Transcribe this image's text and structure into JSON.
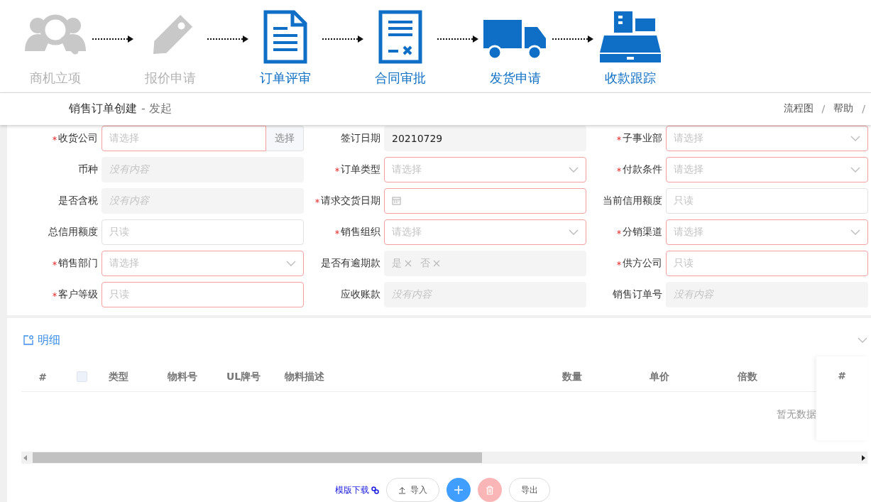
{
  "steps": [
    {
      "label": "商机立项",
      "active": false
    },
    {
      "label": "报价申请",
      "active": false
    },
    {
      "label": "订单评审",
      "active": true
    },
    {
      "label": "合同审批",
      "active": true
    },
    {
      "label": "发货申请",
      "active": true
    },
    {
      "label": "收款跟踪",
      "active": true
    }
  ],
  "title_bar": {
    "title": "销售订单创建",
    "subtitle": "- 发起",
    "links": [
      "流程图",
      "帮助"
    ],
    "separator": "/"
  },
  "fields": [
    {
      "label": "收货公司",
      "kind": "picker",
      "required": true,
      "invalid": true,
      "disabled": false,
      "placeholder": "请选择",
      "button": "选择"
    },
    {
      "label": "签订日期",
      "kind": "input",
      "required": false,
      "invalid": false,
      "disabled": true,
      "value": "20210729"
    },
    {
      "label": "子事业部",
      "kind": "select",
      "required": true,
      "invalid": true,
      "disabled": false,
      "placeholder": "请选择"
    },
    {
      "label": "币种",
      "kind": "input",
      "required": false,
      "invalid": false,
      "disabled": true,
      "placeholder": "没有内容"
    },
    {
      "label": "订单类型",
      "kind": "select",
      "required": true,
      "invalid": true,
      "disabled": false,
      "placeholder": "请选择"
    },
    {
      "label": "付款条件",
      "kind": "select",
      "required": true,
      "invalid": true,
      "disabled": false,
      "placeholder": "请选择"
    },
    {
      "label": "是否含税",
      "kind": "input",
      "required": false,
      "invalid": false,
      "disabled": true,
      "placeholder": "没有内容"
    },
    {
      "label": "请求交货日期",
      "kind": "date",
      "required": true,
      "invalid": true,
      "disabled": false
    },
    {
      "label": "当前信用额度",
      "kind": "input",
      "required": false,
      "invalid": false,
      "disabled": false,
      "placeholder": "只读"
    },
    {
      "label": "总信用额度",
      "kind": "input",
      "required": false,
      "invalid": false,
      "disabled": false,
      "placeholder": "只读"
    },
    {
      "label": "销售组织",
      "kind": "select",
      "required": true,
      "invalid": true,
      "disabled": false,
      "placeholder": "请选择"
    },
    {
      "label": "分销渠道",
      "kind": "select",
      "required": true,
      "invalid": true,
      "disabled": false,
      "placeholder": "请选择"
    },
    {
      "label": "销售部门",
      "kind": "select",
      "required": true,
      "invalid": true,
      "disabled": false,
      "placeholder": "请选择"
    },
    {
      "label": "是否有逾期款",
      "kind": "tags",
      "required": false,
      "invalid": false,
      "disabled": true,
      "tags": [
        "是",
        "否"
      ]
    },
    {
      "label": "供方公司",
      "kind": "input",
      "required": true,
      "invalid": true,
      "disabled": false,
      "placeholder": "只读"
    },
    {
      "label": "客户等级",
      "kind": "input",
      "required": true,
      "invalid": true,
      "disabled": false,
      "placeholder": "只读"
    },
    {
      "label": "应收账款",
      "kind": "input",
      "required": false,
      "invalid": false,
      "disabled": true,
      "placeholder": "没有内容"
    },
    {
      "label": "销售订单号",
      "kind": "input",
      "required": false,
      "invalid": false,
      "disabled": true,
      "placeholder": "没有内容"
    }
  ],
  "detail": {
    "title": "明细",
    "expanded": true,
    "columns": [
      {
        "kind": "text",
        "label": "#"
      },
      {
        "kind": "checkbox",
        "checked": false
      },
      {
        "kind": "text",
        "label": "类型"
      },
      {
        "kind": "text",
        "label": "物料号"
      },
      {
        "kind": "text",
        "label": "UL牌号"
      },
      {
        "kind": "text",
        "label": "物料描述"
      },
      {
        "kind": "text",
        "label": "数量"
      },
      {
        "kind": "text",
        "label": "单价"
      },
      {
        "kind": "text",
        "label": "倍数"
      }
    ],
    "fixed_column": "#",
    "empty_text": "暂无数据",
    "template_link": "模版下载",
    "actions": [
      {
        "kind": "import",
        "label": "导入",
        "disabled": false
      },
      {
        "kind": "add",
        "disabled": false
      },
      {
        "kind": "delete",
        "disabled": true
      },
      {
        "kind": "export",
        "label": "导出",
        "disabled": false
      }
    ]
  }
}
